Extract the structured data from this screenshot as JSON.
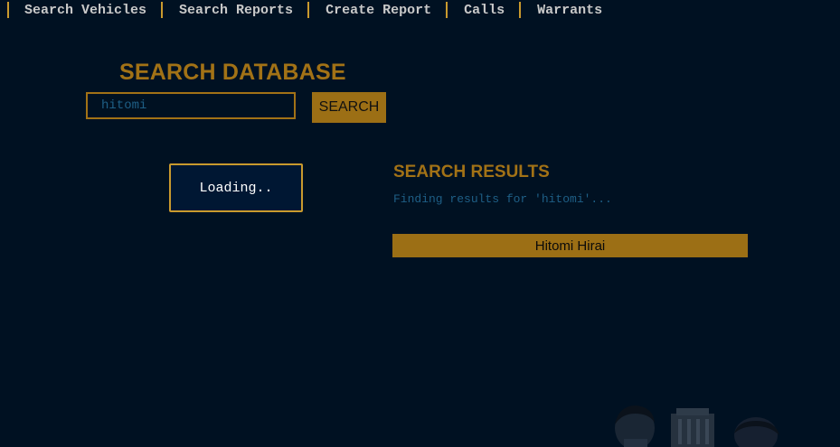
{
  "nav": {
    "items": [
      {
        "label": "Search Vehicles"
      },
      {
        "label": "Search Reports"
      },
      {
        "label": "Create Report"
      },
      {
        "label": "Calls"
      },
      {
        "label": "Warrants"
      }
    ]
  },
  "search": {
    "title": "SEARCH DATABASE",
    "input_value": "hitomi",
    "button_label": "SEARCH"
  },
  "loading": {
    "text": "Loading.."
  },
  "results": {
    "title": "SEARCH RESULTS",
    "status": "Finding results for 'hitomi'...",
    "items": [
      {
        "name": "Hitomi Hirai"
      }
    ]
  },
  "colors": {
    "background": "#001122",
    "accent": "#a27216",
    "status_blue": "#1e5f86"
  }
}
